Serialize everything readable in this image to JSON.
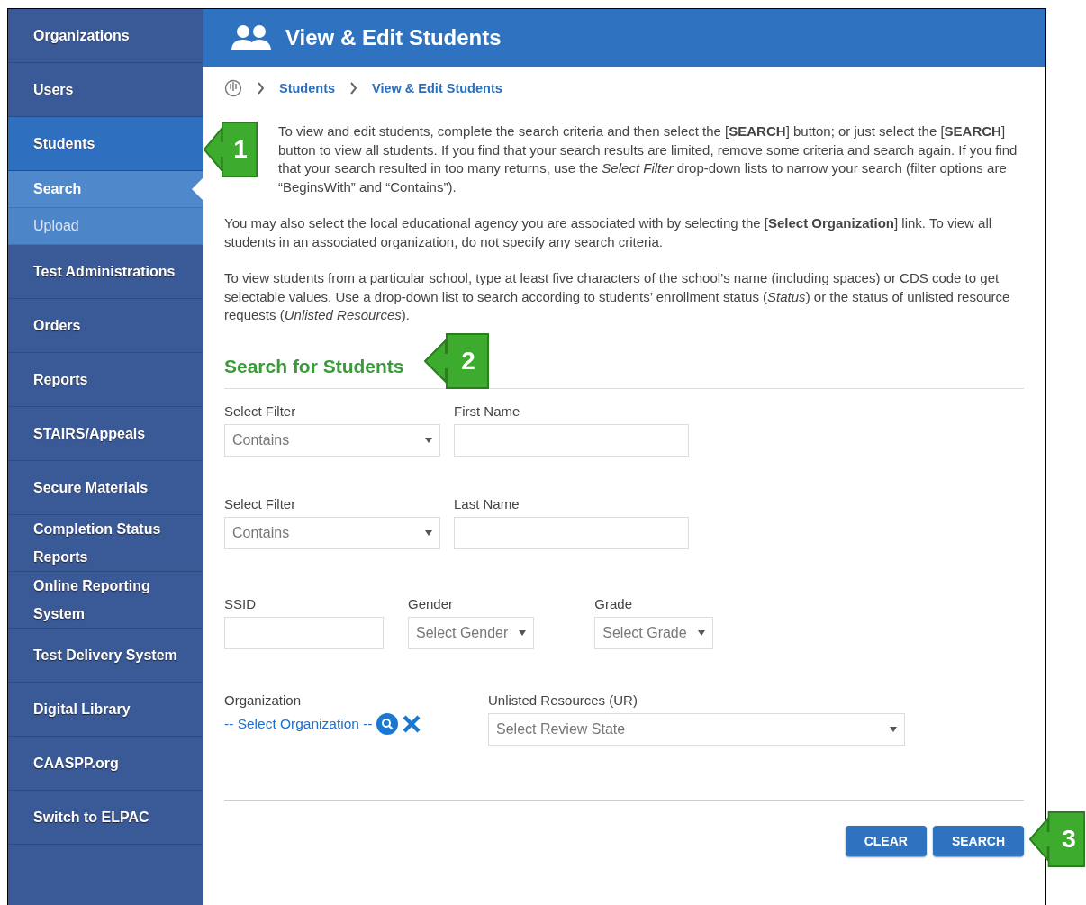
{
  "sidebar": {
    "items": [
      {
        "label": "Organizations",
        "selected": false
      },
      {
        "label": "Users",
        "selected": false
      },
      {
        "label": "Students",
        "selected": true,
        "children": [
          {
            "label": "Search",
            "selected": true
          },
          {
            "label": "Upload",
            "selected": false
          }
        ]
      },
      {
        "label": "Test Administrations",
        "selected": false
      },
      {
        "label": "Orders",
        "selected": false
      },
      {
        "label": "Reports",
        "selected": false
      },
      {
        "label": "STAIRS/Appeals",
        "selected": false
      },
      {
        "label": "Secure Materials",
        "selected": false
      },
      {
        "label": "Completion Status Reports",
        "selected": false
      },
      {
        "label": "Online Reporting System",
        "selected": false
      },
      {
        "label": "Test Delivery System",
        "selected": false
      },
      {
        "label": "Digital Library",
        "selected": false
      },
      {
        "label": "CAASPP.org",
        "selected": false
      },
      {
        "label": "Switch to ELPAC",
        "selected": false
      }
    ]
  },
  "header": {
    "title": "View & Edit Students"
  },
  "breadcrumb": [
    "Students",
    "View & Edit Students"
  ],
  "paragraphs": [
    "To view and edit students, complete the search criteria and then select the [**SEARCH**] button; or just select the [**SEARCH**] button to view all students. If you find that your search results are limited, remove some criteria and search again. If you find that your search resulted in too many returns, use the *Select Filter* drop-down lists to narrow your search (filter options are “BeginsWith” and “Contains”).",
    "You may also select the local educational agency you are associated with by selecting the [**Select Organization**] link. To view all students in an associated organization, do not specify any search criteria.",
    "To view students from a particular school, type at least five characters of the school’s name (including spaces) or CDS code to get selectable values. Use a drop-down list to search according to students’ enrollment status (*Status*) or the status of unlisted resource requests (*Unlisted Resources*)."
  ],
  "search_form": {
    "title": "Search for Students",
    "name_rows": [
      {
        "filter_label": "Select Filter",
        "filter_value": "Contains",
        "name_label": "First Name"
      },
      {
        "filter_label": "Select Filter",
        "filter_value": "Contains",
        "name_label": "Last Name"
      }
    ],
    "ssid": {
      "label": "SSID"
    },
    "gender": {
      "label": "Gender",
      "value": "Select Gender"
    },
    "grade": {
      "label": "Grade",
      "value": "Select Grade"
    },
    "organization": {
      "label": "Organization",
      "link": "-- Select Organization --"
    },
    "unlisted_resources": {
      "label": "Unlisted Resources (UR)",
      "value": "Select Review State"
    },
    "buttons": [
      "CLEAR",
      "SEARCH"
    ]
  },
  "callouts": [
    {
      "number": "1"
    },
    {
      "number": "2"
    },
    {
      "number": "3"
    }
  ]
}
